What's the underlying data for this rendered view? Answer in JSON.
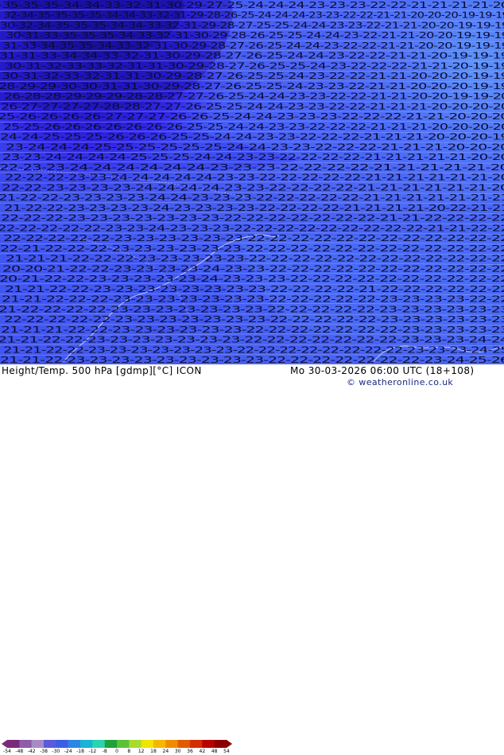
{
  "map": {
    "rows": [
      "-35-35-35-34-34-33-32-31-30-29-27-25-24-24-24-23-23-23-22-22-21-21-21-21-20",
      "32-34-35-35-35-35-34-34-33-32-31-29-28-26-25-24-24-24-23-23-22-22-21-21-20-20-20-19-19-19",
      "30-32-34-35-35-35-34-34-33-32-31-29-28-27-25-25-24-24-23-23-22-21-21-20-20-19-19-19",
      "30-31-33-35-35-35-34-33-32-31-30-29-28-26-25-25-24-24-23-22-21-21-20-20-19-19-19",
      "31-33-34-35-35-34-33-32-31-30-29-28-27-26-25-24-24-23-22-22-21-21-20-20-19-19-19",
      "31-31-33-34-34-33-32-31-30-29-28-27-26-25-24-24-23-22-22-21-21-20-19-19-19",
      "30-31-32-33-33-32-31-31-30-29-28-27-26-25-25-24-23-22-22-22-21-21-20-19-19",
      "30-31-32-33-32-31-31-30-29-28-27-26-25-25-24-23-22-22-21-21-20-20-20-19-19",
      "28-29-29-30-30-31-31-30-29-28-27-26-25-25-24-23-23-22-21-21-20-20-20-19-19",
      "26-28-28-29-29-29-28-28-27-27-26-25-24-24-23-23-22-22-21-21-20-20-19-19-20",
      "26-27-27-27-27-28-28-27-27-26-25-25-24-24-23-23-22-22-21-21-21-20-20-20-20",
      "25-26-26-26-26-27-27-27-26-26-25-24-24-23-23-23-22-22-22-21-21-20-20-20",
      "25-25-26-26-26-26-26-26-26-25-25-24-24-23-23-22-22-22-21-21-21-20-20-20-20",
      "24-24-25-25-25-26-26-26-25-25-24-24-23-23-22-22-22-21-21-21-20-20-20-19",
      "23-24-24-24-25-25-25-25-25-25-24-24-23-23-22-22-22-21-21-21-20-20-20",
      "23-23-24-24-24-24-25-25-25-24-24-23-23-22-22-22-22-21-21-21-21-21-20-20",
      "22-23-23-24-24-24-24-24-24-23-23-23-22-22-22-22-21-21-21-21-21-20",
      "22-22-22-23-23-24-24-24-24-24-23-23-22-22-22-22-22-21-21-21-21-21-21-20",
      "22-22-23-23-23-23-24-24-24-24-23-23-22-22-22-22-21-21-21-21-21-21-20",
      "21-22-22-23-23-23-23-24-24-23-23-23-22-22-22-22-22-21-21-21-21-21-21-21",
      "21-22-22-23-23-23-23-24-23-23-23-23-22-22-22-22-21-21-21-21-20-22-21-21",
      "22-22-22-23-23-23-23-23-23-23-22-22-22-22-22-22-22-21-21-22-22-22-22",
      "22-22-22-22-22-23-23-24-23-23-23-22-22-22-22-22-22-22-22-22-21-21-22-22",
      "22-22-22-22-22-23-23-23-23-23-23-22-22-22-22-22-22-22-22-22-22-22-22",
      "22-21-22-22-22-23-23-23-23-23-23-22-22-22-22-22-22-22-22-22-22-22-22",
      "21-21-21-22-22-22-23-23-23-23-23-22-22-22-22-22-22-22-22-22-22-22-22",
      "20-20-21-22-22-23-23-23-23-24-23-23-22-22-22-22-22-22-22-22-22-22-22",
      "20-21-22-22-23-23-23-23-23-24-23-23-23-22-22-22-22-22-22-22-22-22-22",
      "21-21-22-22-23-23-23-23-23-23-23-23-22-22-22-22-21-22-22-22-22-22-22",
      "21-21-22-22-22-23-23-23-23-23-23-23-22-22-22-22-22-23-23-23-23-22-22",
      "21-22-22-22-22-23-23-23-23-23-23-23-22-22-22-22-22-23-23-23-23-23-23",
      "22-22-22-22-22-23-23-23-23-23-23-23-22-22-22-22-22-23-23-23-23-23-23",
      "21-21-21-22-22-23-23-23-23-23-23-22-22-22-22-22-22-22-23-23-23-23-23",
      "21-21-22-22-23-23-23-23-23-23-23-22-22-22-22-22-22-22-23-23-23-24-24",
      "21-21-22-22-23-23-23-23-23-23-23-22-22-22-22-22-22-22-22-23-23-23-24-25",
      "21-21-22-23-23-23-23-23-23-23-23-23-22-22-22-22-22-22-22-23-24-25-26"
    ]
  },
  "footer": {
    "left_title": "Height/Temp. 500 hPa [gdmp][°C] ICON",
    "datetime": "Mo 30-03-2026 06:00 UTC (18+108)",
    "copyright": "© weatheronline.co.uk",
    "scale_labels": [
      "-54",
      "-48",
      "-42",
      "-38",
      "-30",
      "-24",
      "-18",
      "-12",
      "-8",
      "0",
      "8",
      "12",
      "18",
      "24",
      "30",
      "36",
      "42",
      "48",
      "54"
    ],
    "scale_colors": [
      "#7a2a7a",
      "#8e5ca8",
      "#a78bc4",
      "#5a5adb",
      "#3a5ee6",
      "#2b86e6",
      "#19b3d4",
      "#2bd4b0",
      "#1fa13c",
      "#5bc236",
      "#a6dc2e",
      "#f0e400",
      "#f5b800",
      "#f08a00",
      "#e05a00",
      "#d23000",
      "#b80000",
      "#8a0000"
    ]
  }
}
